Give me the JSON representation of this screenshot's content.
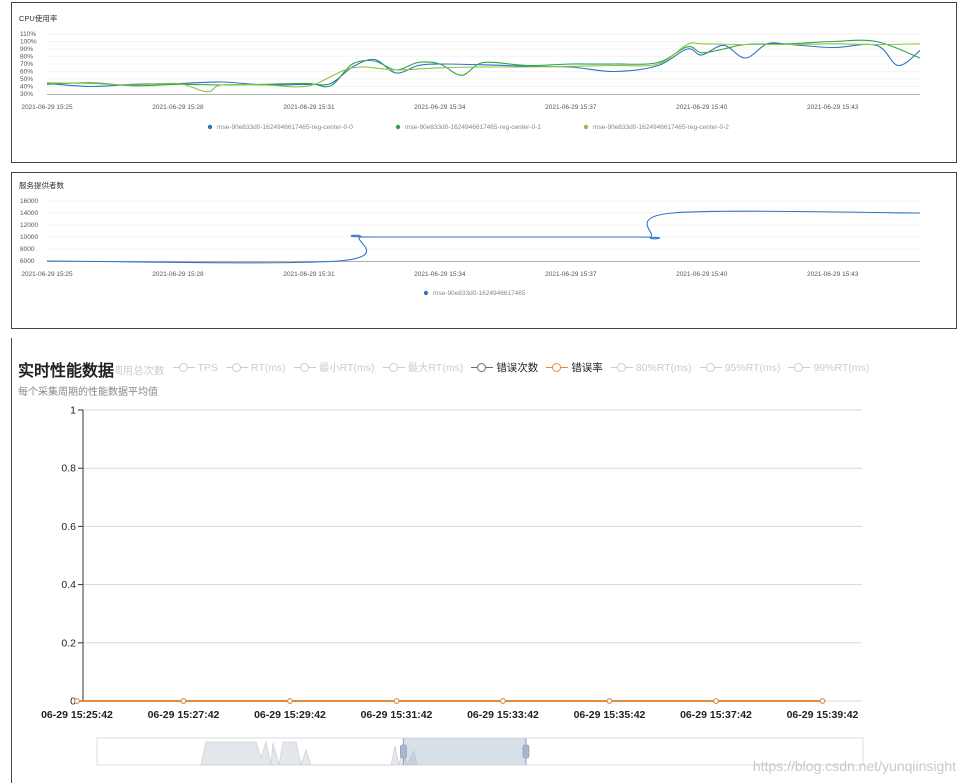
{
  "chart_data": [
    {
      "type": "line",
      "title": "CPU使用率",
      "x_ticks": [
        "2021-06-29 15:25",
        "2021-06-29 15:28",
        "2021-06-29 15:31",
        "2021-06-29 15:34",
        "2021-06-29 15:37",
        "2021-06-29 15:40",
        "2021-06-29 15:43"
      ],
      "y_ticks": [
        "110%",
        "100%",
        "90%",
        "80%",
        "70%",
        "60%",
        "50%",
        "40%",
        "30%"
      ],
      "ylim": [
        30,
        110
      ],
      "x_range": [
        "2021-06-29 15:25",
        "2021-06-29 15:45"
      ],
      "grid": true,
      "legend_position": "bottom",
      "series": [
        {
          "name": "mse-90e833d0-1624946617465-reg-center-0-0",
          "color": "#2f74c6",
          "x": [
            "15:25:00",
            "15:26:00",
            "15:27:00",
            "15:28:00",
            "15:29:00",
            "15:30:00",
            "15:31:00",
            "15:31:30",
            "15:32:00",
            "15:32:30",
            "15:33:00",
            "15:33:30",
            "15:34:00",
            "15:35:00",
            "15:36:00",
            "15:37:00",
            "15:38:00",
            "15:39:00",
            "15:39:40",
            "15:40:00",
            "15:40:30",
            "15:41:00",
            "15:41:30",
            "15:42:00",
            "15:43:00",
            "15:44:00",
            "15:44:30",
            "15:45:00"
          ],
          "values": [
            44,
            40,
            43,
            44,
            46,
            42,
            43,
            44,
            66,
            76,
            58,
            68,
            70,
            69,
            67,
            66,
            60,
            68,
            90,
            82,
            95,
            78,
            97,
            96,
            92,
            95,
            68,
            88
          ]
        },
        {
          "name": "mse-90e833d0-1624946617465-reg-center-0-1",
          "color": "#2ea14b",
          "x": [
            "15:25:00",
            "15:26:00",
            "15:27:00",
            "15:28:00",
            "15:29:00",
            "15:30:00",
            "15:31:00",
            "15:31:30",
            "15:32:00",
            "15:32:30",
            "15:33:00",
            "15:33:30",
            "15:34:00",
            "15:34:30",
            "15:35:00",
            "15:36:00",
            "15:37:00",
            "15:38:00",
            "15:39:00",
            "15:39:40",
            "15:40:00",
            "15:40:30",
            "15:41:00",
            "15:42:00",
            "15:43:00",
            "15:44:00",
            "15:45:00"
          ],
          "values": [
            43,
            45,
            41,
            43,
            42,
            43,
            44,
            41,
            70,
            74,
            62,
            72,
            70,
            55,
            72,
            68,
            70,
            70,
            72,
            93,
            85,
            90,
            96,
            97,
            100,
            100,
            78
          ]
        },
        {
          "name": "mse-90e833d0-1624946617465-reg-center-0-2",
          "color": "#8cc43d",
          "x": [
            "15:25:00",
            "15:26:00",
            "15:27:00",
            "15:28:00",
            "15:28:40",
            "15:29:00",
            "15:30:00",
            "15:31:00",
            "15:32:00",
            "15:33:00",
            "15:34:00",
            "15:35:00",
            "15:36:00",
            "15:37:00",
            "15:38:00",
            "15:39:00",
            "15:39:40",
            "15:40:00",
            "15:41:00",
            "15:42:00",
            "15:43:00",
            "15:44:00",
            "15:45:00"
          ],
          "values": [
            45,
            44,
            42,
            44,
            33,
            42,
            42,
            41,
            65,
            62,
            65,
            66,
            66,
            67,
            68,
            70,
            96,
            97,
            96,
            96,
            97,
            96,
            97
          ]
        }
      ]
    },
    {
      "type": "line",
      "title": "服务提供者数",
      "x_ticks": [
        "2021-06-29 15:25",
        "2021-06-29 15:28",
        "2021-06-29 15:31",
        "2021-06-29 15:34",
        "2021-06-29 15:37",
        "2021-06-29 15:40",
        "2021-06-29 15:43"
      ],
      "y_ticks": [
        "16000",
        "14000",
        "12000",
        "10000",
        "8000",
        "6000"
      ],
      "ylim": [
        6000,
        16000
      ],
      "x_range": [
        "2021-06-29 15:25",
        "2021-06-29 15:45"
      ],
      "grid": true,
      "legend_position": "bottom",
      "series": [
        {
          "name": "mse-90e833d0-1624946617465",
          "color": "#2f74c6",
          "x": [
            "15:25:00",
            "15:31:40",
            "15:32:10",
            "15:32:30",
            "15:38:30",
            "15:38:50",
            "15:39:20",
            "15:45:00"
          ],
          "values": [
            6000,
            6000,
            10000,
            10000,
            10000,
            10000,
            14000,
            14000
          ]
        }
      ]
    },
    {
      "type": "line",
      "title": "实时性能数据",
      "subtitle": "每个采集周期的性能数据平均值",
      "legend": [
        "调用总次数",
        "TPS",
        "RT(ms)",
        "最小RT(ms)",
        "最大RT(ms)",
        "错误次数",
        "错误率",
        "80%RT(ms)",
        "95%RT(ms)",
        "99%RT(ms)"
      ],
      "legend_active": [
        "错误次数",
        "错误率"
      ],
      "legend_position": "top",
      "y_ticks": [
        "1",
        "0.8",
        "0.6",
        "0.4",
        "0.2",
        "0"
      ],
      "ylim": [
        0,
        1
      ],
      "x_ticks": [
        "06-29 15:25:42",
        "06-29 15:27:42",
        "06-29 15:29:42",
        "06-29 15:31:42",
        "06-29 15:33:42",
        "06-29 15:35:42",
        "06-29 15:37:42",
        "06-29 15:39:42"
      ],
      "grid": true,
      "series": [
        {
          "name": "错误次数",
          "color": "#56757f",
          "values": [
            0,
            0,
            0,
            0,
            0,
            0,
            0,
            0
          ]
        },
        {
          "name": "错误率",
          "color": "#e6883c",
          "values": [
            0,
            0,
            0,
            0,
            0,
            0,
            0,
            0
          ]
        }
      ],
      "data_zoom": {
        "start": 0.4,
        "end": 0.56
      }
    }
  ],
  "realtime": {
    "title": "实时性能数据",
    "subtitle": "每个采集周期的性能数据平均值"
  },
  "watermark": "https://blog.csdn.net/yunqiinsight"
}
